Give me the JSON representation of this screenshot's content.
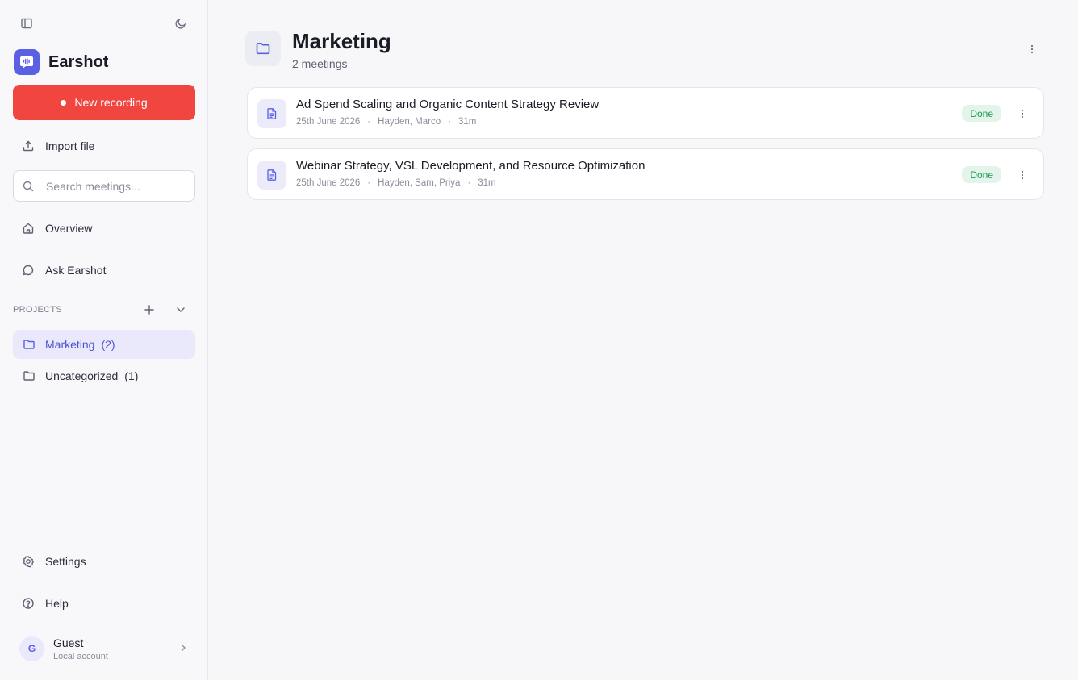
{
  "sidebar": {
    "brand": {
      "name": "Earshot"
    },
    "new_recording_label": "New recording",
    "import_label": "Import file",
    "search": {
      "placeholder": "Search meetings..."
    },
    "nav": {
      "overview": "Overview",
      "ask": "Ask Earshot"
    },
    "projects": {
      "label": "PROJECTS",
      "items": [
        {
          "name": "Marketing",
          "count": "(2)",
          "active": true
        },
        {
          "name": "Uncategorized",
          "count": "(1)",
          "active": false
        }
      ]
    },
    "settings_label": "Settings",
    "help_label": "Help",
    "user": {
      "initial": "G",
      "name": "Guest",
      "subtitle": "Local account"
    }
  },
  "main": {
    "title": "Marketing",
    "subtitle": "2 meetings",
    "meetings": [
      {
        "title": "Ad Spend Scaling and Organic Content Strategy Review",
        "date": "25th June 2026",
        "participants": "Hayden, Marco",
        "duration": "31m",
        "status": "Done"
      },
      {
        "title": "Webinar Strategy, VSL Development, and Resource Optimization",
        "date": "25th June 2026",
        "participants": "Hayden, Sam, Priya",
        "duration": "31m",
        "status": "Done"
      }
    ]
  },
  "colors": {
    "accent": "#5b5fe3",
    "record": "#f0463f",
    "done_bg": "#e3f5ea",
    "done_text": "#1f9a52"
  }
}
